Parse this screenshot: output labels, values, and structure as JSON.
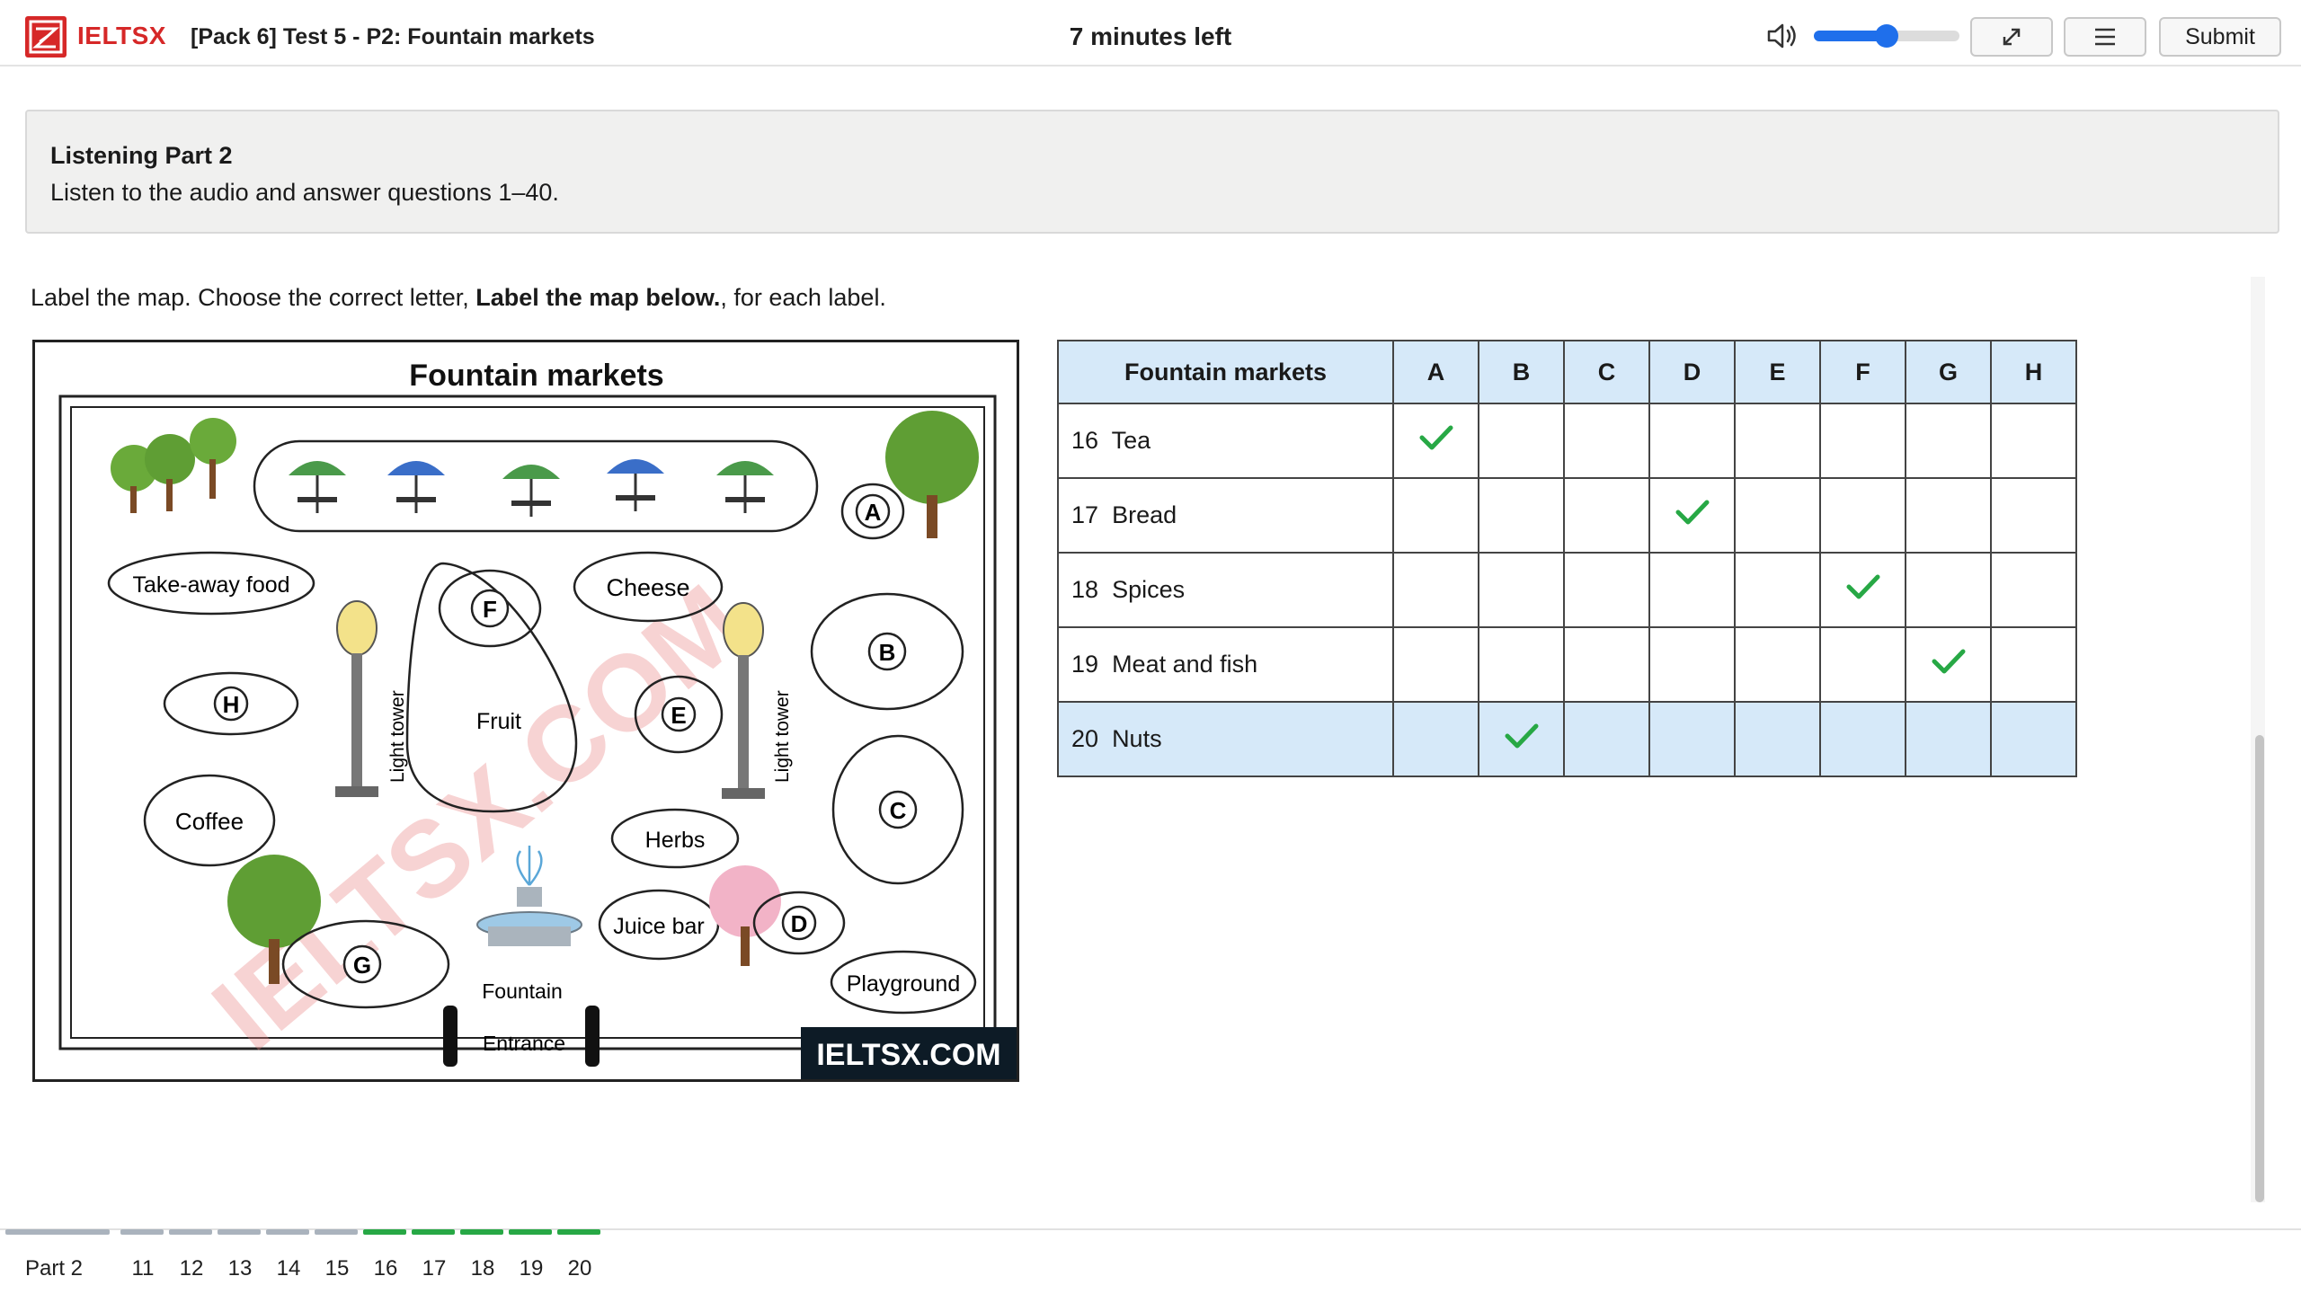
{
  "header": {
    "brand": "IELTSX",
    "test_title": "[Pack 6] Test 5 - P2: Fountain markets",
    "timer": "7 minutes left",
    "volume_level": 0.5,
    "submit_label": "Submit"
  },
  "instructions": {
    "title": "Listening Part 2",
    "text": "Listen to the audio and answer questions 1–40."
  },
  "question": {
    "prefix": "Label the map. Choose the correct letter, ",
    "bold": "Label the map below.",
    "suffix": ", for each label."
  },
  "map": {
    "title": "Fountain markets",
    "watermark": "IELTSX.COM",
    "banner": "IELTSX.COM",
    "labels": {
      "takeaway": "Take-away food",
      "cheese": "Cheese",
      "fruit": "Fruit",
      "coffee": "Coffee",
      "herbs": "Herbs",
      "juice_bar": "Juice bar",
      "playground": "Playground",
      "fountain": "Fountain",
      "entrance": "Entrance",
      "light_tower": "Light tower"
    },
    "letters": [
      "A",
      "B",
      "C",
      "D",
      "E",
      "F",
      "G",
      "H"
    ]
  },
  "table": {
    "header": "Fountain markets",
    "columns": [
      "A",
      "B",
      "C",
      "D",
      "E",
      "F",
      "G",
      "H"
    ],
    "rows": [
      {
        "number": "16",
        "label": "Tea",
        "answer": "A"
      },
      {
        "number": "17",
        "label": "Bread",
        "answer": "D"
      },
      {
        "number": "18",
        "label": "Spices",
        "answer": "F"
      },
      {
        "number": "19",
        "label": "Meat and fish",
        "answer": "G"
      },
      {
        "number": "20",
        "label": "Nuts",
        "answer": "B"
      }
    ]
  },
  "footer": {
    "part_label": "Part 2",
    "questions": [
      "11",
      "12",
      "13",
      "14",
      "15",
      "16",
      "17",
      "18",
      "19",
      "20"
    ],
    "answered": [
      "16",
      "17",
      "18",
      "19",
      "20"
    ]
  },
  "colors": {
    "brand_red": "#d62828",
    "accent_blue": "#1f6feb",
    "check_green": "#27a845",
    "header_blue": "#d6e9f9",
    "progress_gray": "#aab3bd"
  }
}
